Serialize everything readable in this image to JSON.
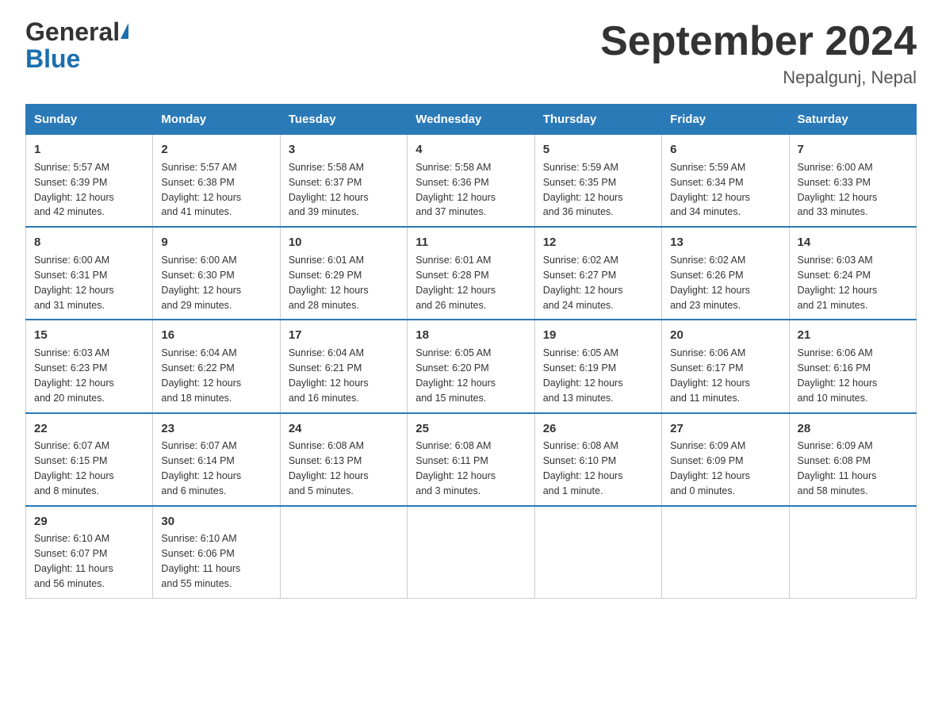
{
  "logo": {
    "name": "General",
    "name2": "Blue"
  },
  "title": "September 2024",
  "location": "Nepalgunj, Nepal",
  "days_of_week": [
    "Sunday",
    "Monday",
    "Tuesday",
    "Wednesday",
    "Thursday",
    "Friday",
    "Saturday"
  ],
  "weeks": [
    [
      {
        "num": "1",
        "sunrise": "5:57 AM",
        "sunset": "6:39 PM",
        "daylight": "12 hours and 42 minutes."
      },
      {
        "num": "2",
        "sunrise": "5:57 AM",
        "sunset": "6:38 PM",
        "daylight": "12 hours and 41 minutes."
      },
      {
        "num": "3",
        "sunrise": "5:58 AM",
        "sunset": "6:37 PM",
        "daylight": "12 hours and 39 minutes."
      },
      {
        "num": "4",
        "sunrise": "5:58 AM",
        "sunset": "6:36 PM",
        "daylight": "12 hours and 37 minutes."
      },
      {
        "num": "5",
        "sunrise": "5:59 AM",
        "sunset": "6:35 PM",
        "daylight": "12 hours and 36 minutes."
      },
      {
        "num": "6",
        "sunrise": "5:59 AM",
        "sunset": "6:34 PM",
        "daylight": "12 hours and 34 minutes."
      },
      {
        "num": "7",
        "sunrise": "6:00 AM",
        "sunset": "6:33 PM",
        "daylight": "12 hours and 33 minutes."
      }
    ],
    [
      {
        "num": "8",
        "sunrise": "6:00 AM",
        "sunset": "6:31 PM",
        "daylight": "12 hours and 31 minutes."
      },
      {
        "num": "9",
        "sunrise": "6:00 AM",
        "sunset": "6:30 PM",
        "daylight": "12 hours and 29 minutes."
      },
      {
        "num": "10",
        "sunrise": "6:01 AM",
        "sunset": "6:29 PM",
        "daylight": "12 hours and 28 minutes."
      },
      {
        "num": "11",
        "sunrise": "6:01 AM",
        "sunset": "6:28 PM",
        "daylight": "12 hours and 26 minutes."
      },
      {
        "num": "12",
        "sunrise": "6:02 AM",
        "sunset": "6:27 PM",
        "daylight": "12 hours and 24 minutes."
      },
      {
        "num": "13",
        "sunrise": "6:02 AM",
        "sunset": "6:26 PM",
        "daylight": "12 hours and 23 minutes."
      },
      {
        "num": "14",
        "sunrise": "6:03 AM",
        "sunset": "6:24 PM",
        "daylight": "12 hours and 21 minutes."
      }
    ],
    [
      {
        "num": "15",
        "sunrise": "6:03 AM",
        "sunset": "6:23 PM",
        "daylight": "12 hours and 20 minutes."
      },
      {
        "num": "16",
        "sunrise": "6:04 AM",
        "sunset": "6:22 PM",
        "daylight": "12 hours and 18 minutes."
      },
      {
        "num": "17",
        "sunrise": "6:04 AM",
        "sunset": "6:21 PM",
        "daylight": "12 hours and 16 minutes."
      },
      {
        "num": "18",
        "sunrise": "6:05 AM",
        "sunset": "6:20 PM",
        "daylight": "12 hours and 15 minutes."
      },
      {
        "num": "19",
        "sunrise": "6:05 AM",
        "sunset": "6:19 PM",
        "daylight": "12 hours and 13 minutes."
      },
      {
        "num": "20",
        "sunrise": "6:06 AM",
        "sunset": "6:17 PM",
        "daylight": "12 hours and 11 minutes."
      },
      {
        "num": "21",
        "sunrise": "6:06 AM",
        "sunset": "6:16 PM",
        "daylight": "12 hours and 10 minutes."
      }
    ],
    [
      {
        "num": "22",
        "sunrise": "6:07 AM",
        "sunset": "6:15 PM",
        "daylight": "12 hours and 8 minutes."
      },
      {
        "num": "23",
        "sunrise": "6:07 AM",
        "sunset": "6:14 PM",
        "daylight": "12 hours and 6 minutes."
      },
      {
        "num": "24",
        "sunrise": "6:08 AM",
        "sunset": "6:13 PM",
        "daylight": "12 hours and 5 minutes."
      },
      {
        "num": "25",
        "sunrise": "6:08 AM",
        "sunset": "6:11 PM",
        "daylight": "12 hours and 3 minutes."
      },
      {
        "num": "26",
        "sunrise": "6:08 AM",
        "sunset": "6:10 PM",
        "daylight": "12 hours and 1 minute."
      },
      {
        "num": "27",
        "sunrise": "6:09 AM",
        "sunset": "6:09 PM",
        "daylight": "12 hours and 0 minutes."
      },
      {
        "num": "28",
        "sunrise": "6:09 AM",
        "sunset": "6:08 PM",
        "daylight": "11 hours and 58 minutes."
      }
    ],
    [
      {
        "num": "29",
        "sunrise": "6:10 AM",
        "sunset": "6:07 PM",
        "daylight": "11 hours and 56 minutes."
      },
      {
        "num": "30",
        "sunrise": "6:10 AM",
        "sunset": "6:06 PM",
        "daylight": "11 hours and 55 minutes."
      },
      null,
      null,
      null,
      null,
      null
    ]
  ],
  "labels": {
    "sunrise": "Sunrise:",
    "sunset": "Sunset:",
    "daylight": "Daylight:"
  }
}
